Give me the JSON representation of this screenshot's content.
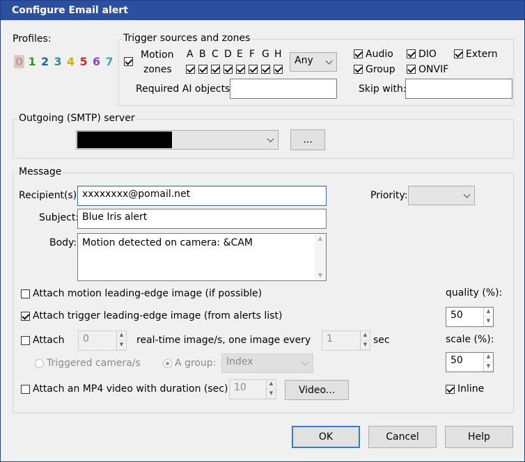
{
  "title": "Configure Email alert",
  "profiles": {
    "label": "Profiles:",
    "items": [
      {
        "n": "0",
        "color": "#c0a0a0"
      },
      {
        "n": "1",
        "color": "#2aa02a"
      },
      {
        "n": "2",
        "color": "#2060c0"
      },
      {
        "n": "3",
        "color": "#3090a0"
      },
      {
        "n": "4",
        "color": "#d0b000"
      },
      {
        "n": "5",
        "color": "#c03030"
      },
      {
        "n": "6",
        "color": "#8050b0"
      },
      {
        "n": "7",
        "color": "#30b0a0"
      }
    ]
  },
  "trigger": {
    "group_label": "Trigger sources and zones",
    "motion": "Motion",
    "zones": "zones",
    "zone_letters": [
      "A",
      "B",
      "C",
      "D",
      "E",
      "F",
      "G",
      "H"
    ],
    "any": "Any",
    "audio": "Audio",
    "dio": "DIO",
    "extern": "Extern",
    "group": "Group",
    "onvif": "ONVIF",
    "req_ai": "Required AI objects:",
    "skip_with": "Skip with:"
  },
  "smtp": {
    "group_label": "Outgoing (SMTP) server",
    "browse": "..."
  },
  "message": {
    "group_label": "Message",
    "recipient_label": "Recipient(s):",
    "recipient_value": "xxxxxxxx@pomail.net",
    "priority_label": "Priority:",
    "subject_label": "Subject:",
    "subject_value": "Blue Iris alert",
    "body_label": "Body:",
    "body_value": "Motion detected on camera: &CAM",
    "attach_motion": "Attach motion leading-edge image (if possible)",
    "attach_trigger": "Attach trigger leading-edge image (from alerts list)",
    "attach": "Attach",
    "attach_count": "0",
    "realtime": "real-time image/s, one image every",
    "every_value": "1",
    "sec": "sec",
    "triggered_cam": "Triggered camera/s",
    "a_group": "A group:",
    "group_value": "Index",
    "mp4": "Attach an MP4 video with duration (sec):",
    "mp4_value": "10",
    "video_btn": "Video...",
    "quality_label": "quality (%):",
    "quality_value": "50",
    "scale_label": "scale (%):",
    "scale_value": "50",
    "inline": "Inline"
  },
  "buttons": {
    "ok": "OK",
    "cancel": "Cancel",
    "help": "Help"
  }
}
